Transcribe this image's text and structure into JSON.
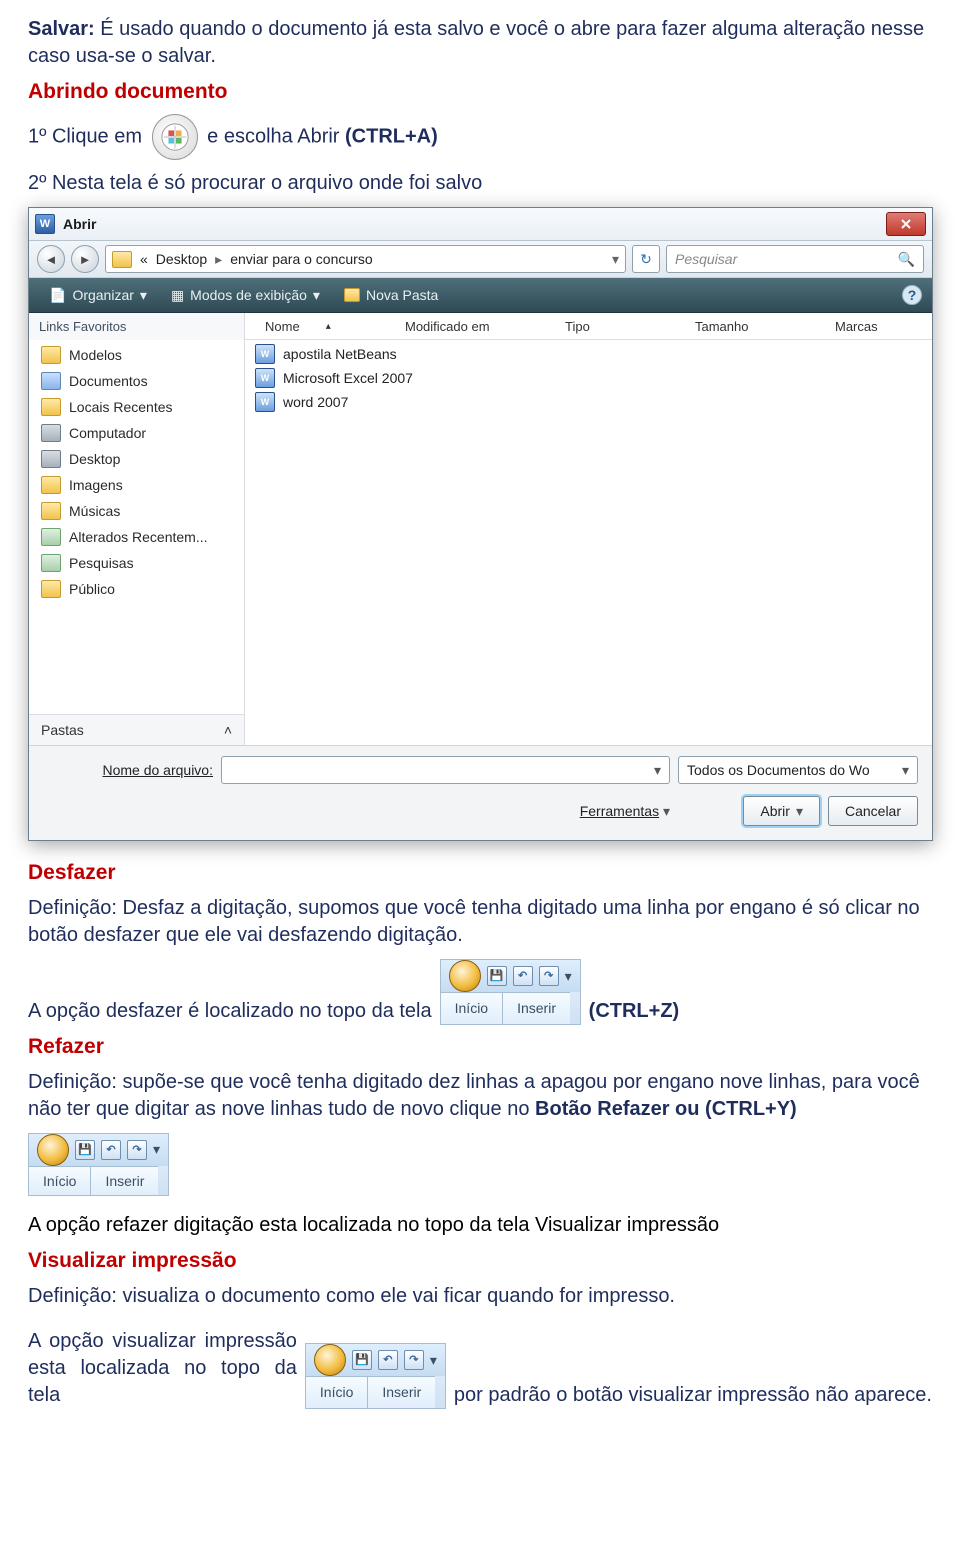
{
  "text": {
    "salvar_label": "Salvar:",
    "salvar_def": " É usado quando o documento já esta salvo e você o abre para fazer alguma alteração nesse caso usa-se o salvar.",
    "abrindo_heading": "Abrindo documento",
    "step1a": "1º Clique em ",
    "step1b": " e escolha Abrir ",
    "step1c": "(CTRL+A)",
    "step2": "2º Nesta tela é só procurar o arquivo onde foi salvo",
    "desfazer_heading": "Desfazer",
    "desfazer_def": "Definição: Desfaz a digitação, supomos que você tenha digitado uma linha por engano é só clicar no botão desfazer que ele vai desfazendo digitação.",
    "desfazer_loc_a": "A opção desfazer é localizado no topo da tela ",
    "desfazer_loc_b": " (CTRL+Z)",
    "refazer_heading": "Refazer",
    "refazer_def_a": "Definição: supõe-se que você tenha digitado dez linhas a apagou por engano nove linhas, para você não ter que digitar as nove linhas tudo de novo clique no ",
    "refazer_def_b": "Botão Refazer ou (CTRL+Y)",
    "refazer_loc": "A opção refazer digitação esta localizada no topo da tela Visualizar impressão",
    "vis_heading": "Visualizar impressão",
    "vis_def": "Definição: visualiza o documento como ele vai ficar quando for impresso.",
    "vis_loc_a": "A opção visualizar impressão esta localizada no topo da tela ",
    "vis_loc_b": "por padrão o botão visualizar impressão não aparece."
  },
  "dialog": {
    "title": "Abrir",
    "breadcrumb": {
      "prefix": "«",
      "part1": "Desktop",
      "part2": "enviar para o concurso"
    },
    "search_placeholder": "Pesquisar",
    "toolbar": {
      "organize": "Organizar",
      "views": "Modos de exibição",
      "newfolder": "Nova Pasta"
    },
    "sidebar_heading": "Links Favoritos",
    "sidebar": [
      "Modelos",
      "Documentos",
      "Locais Recentes",
      "Computador",
      "Desktop",
      "Imagens",
      "Músicas",
      "Alterados Recentem...",
      "Pesquisas",
      "Público"
    ],
    "pastas": "Pastas",
    "columns": {
      "name": "Nome",
      "mod": "Modificado em",
      "type": "Tipo",
      "size": "Tamanho",
      "marks": "Marcas"
    },
    "files": [
      "apostila NetBeans",
      "Microsoft Excel 2007",
      "word 2007"
    ],
    "filename_label": "Nome do arquivo:",
    "filetype": "Todos os Documentos do Wo",
    "tools_label": "Ferramentas",
    "open_btn": "Abrir",
    "cancel_btn": "Cancelar"
  },
  "ribbon": {
    "inicio": "Início",
    "inserir": "Inserir"
  }
}
